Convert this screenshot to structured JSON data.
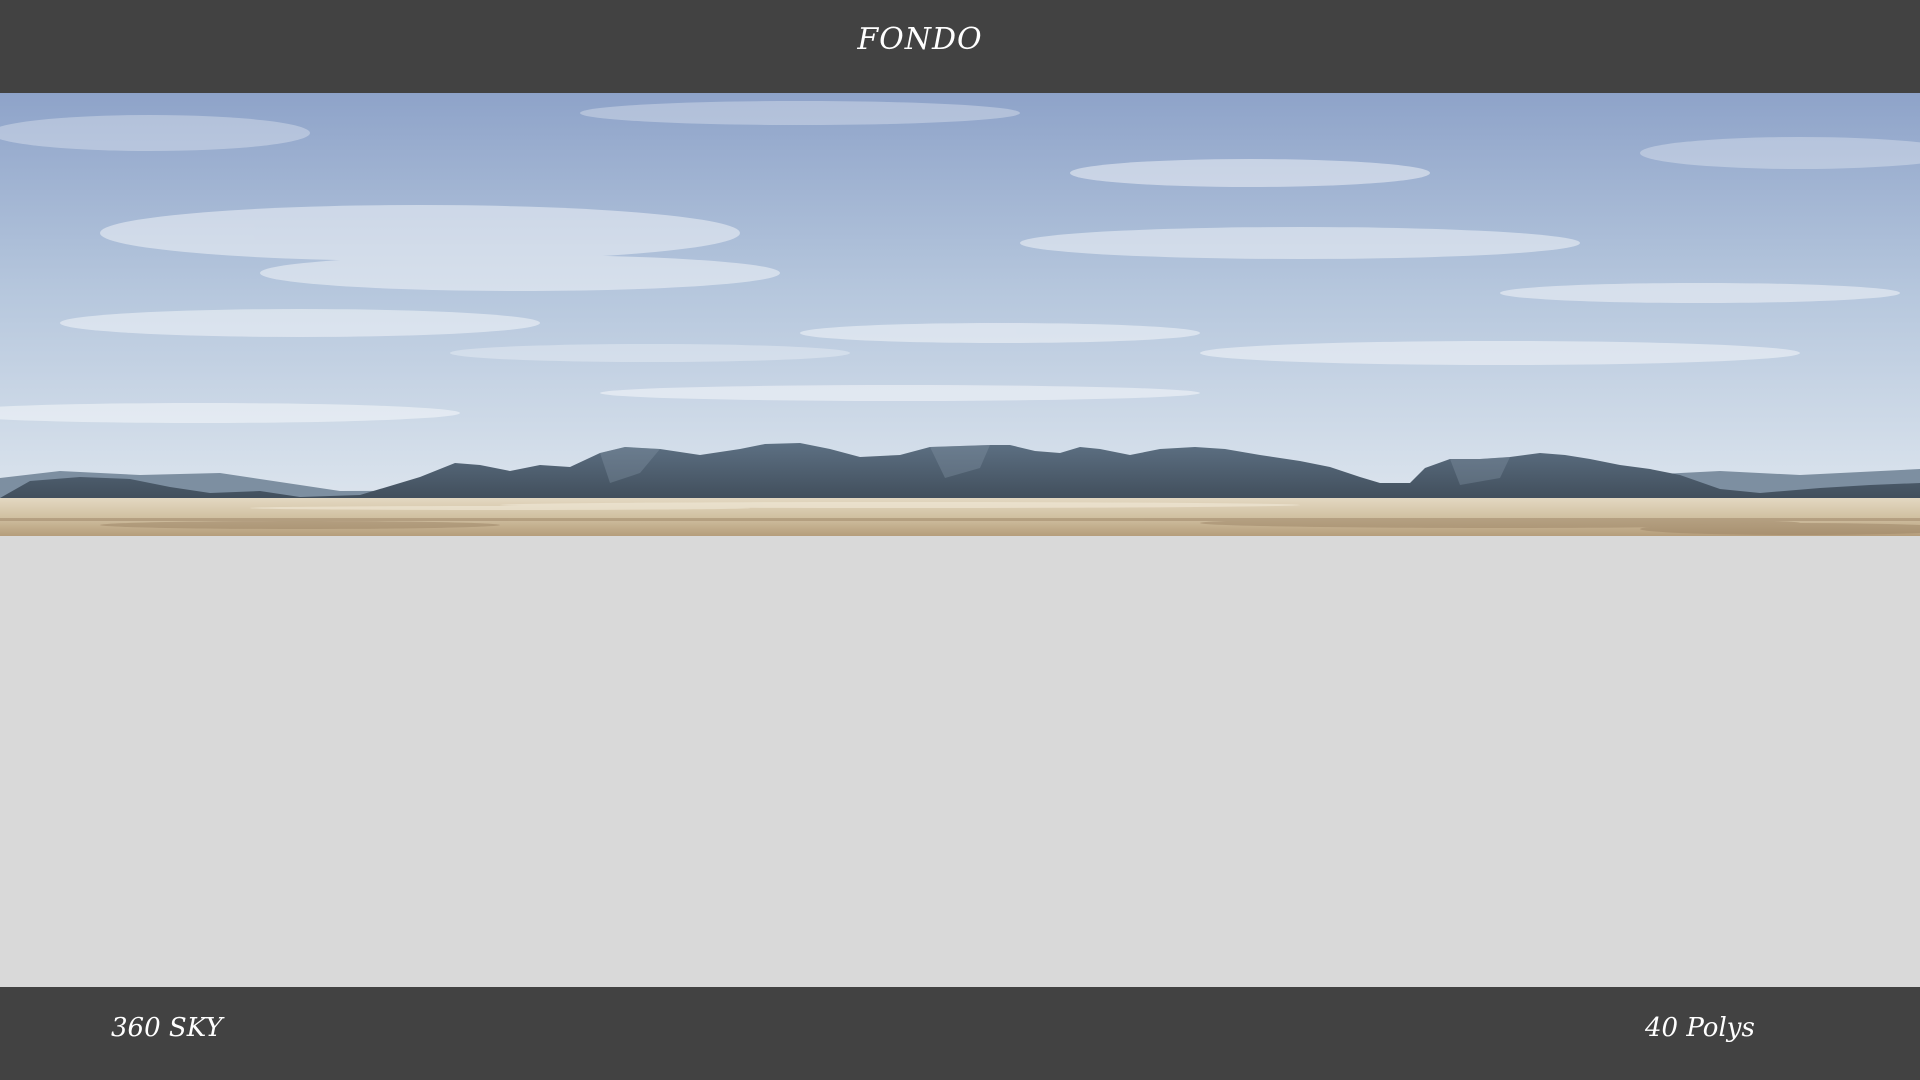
{
  "header": {
    "title": "FONDO"
  },
  "panorama": {
    "image_name": "desert-mountain-sky-panorama",
    "colors": {
      "sky_top": "#8ea3c9",
      "sky_mid": "#b6c7dd",
      "sky_horizon": "#dbe4ee",
      "mountains_far": "#6f8398",
      "mountains_near": "#4d5d6d",
      "desert": "#c9b89a",
      "desert_dark": "#8a7458"
    }
  },
  "footer": {
    "left_label": "360 SKY",
    "right_label": "40 Polys"
  },
  "colors": {
    "bar_background": "#424242",
    "content_background": "#d9d9d9",
    "text": "#ffffff"
  }
}
